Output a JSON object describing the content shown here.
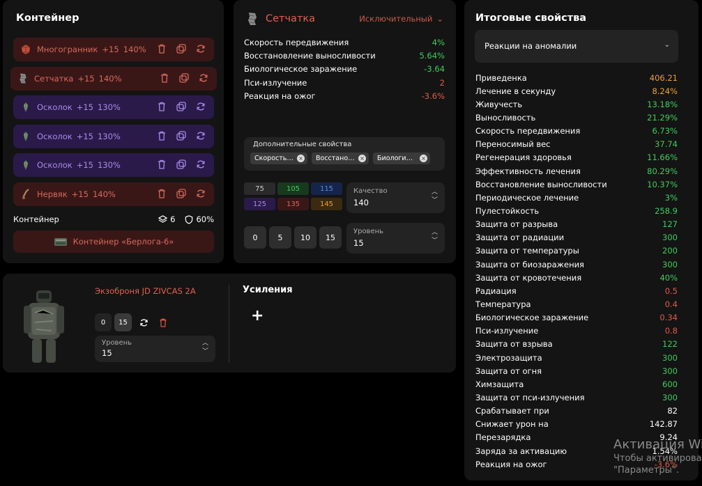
{
  "container": {
    "title": "Контейнер",
    "artifacts": [
      {
        "name": "Многогранник",
        "plus": "+15",
        "percent": "140%",
        "tone": "red",
        "icon": "polyhedron-artifact-icon"
      },
      {
        "name": "Сетчатка",
        "plus": "+15",
        "percent": "140%",
        "tone": "red",
        "icon": "mesh-artifact-icon"
      },
      {
        "name": "Осколок",
        "plus": "+15",
        "percent": "130%",
        "tone": "purple",
        "icon": "shard-artifact-icon"
      },
      {
        "name": "Осколок",
        "plus": "+15",
        "percent": "130%",
        "tone": "purple",
        "icon": "shard-artifact-icon"
      },
      {
        "name": "Осколок",
        "plus": "+15",
        "percent": "130%",
        "tone": "purple",
        "icon": "shard-artifact-icon"
      },
      {
        "name": "Нервяк",
        "plus": "+15",
        "percent": "140%",
        "tone": "red",
        "icon": "nerve-artifact-icon"
      }
    ],
    "footer_label": "Контейнер",
    "slots": "6",
    "protection": "60%",
    "container_button": "Контейнер «Берлога-6»"
  },
  "artifact_detail": {
    "name": "Сетчатка",
    "rarity": "Исключительный",
    "properties": [
      {
        "label": "Скорость передвижения",
        "value": "4%",
        "tone": "g"
      },
      {
        "label": "Восстановление выносливости",
        "value": "5.64%",
        "tone": "g"
      },
      {
        "label": "Биологическое заражение",
        "value": "-3.64",
        "tone": "g"
      },
      {
        "label": "Пси-излучение",
        "value": "2",
        "tone": "r"
      },
      {
        "label": "Реакция на ожог",
        "value": "-3.6%",
        "tone": "r"
      }
    ],
    "additional_label": "Дополнительные свойства",
    "chips": [
      "Скорость передвижения",
      "Восстановление выносливости",
      "Биологическое заражение"
    ],
    "quality_values": [
      "75",
      "105",
      "115",
      "125",
      "135",
      "145"
    ],
    "quality_label": "Качество",
    "quality_value": "140",
    "level_buttons": [
      "0",
      "5",
      "10",
      "15"
    ],
    "level_label": "Уровень",
    "level_value": "15"
  },
  "armor": {
    "name": "Экзоброня JD ZIVCAS 2A",
    "level_buttons": [
      "0",
      "15"
    ],
    "level_label": "Уровень",
    "level_value": "15",
    "boosts_title": "Усиления",
    "add_symbol": "+"
  },
  "final": {
    "title": "Итоговые свойства",
    "select_value": "Реакции на аномалии",
    "rows": [
      {
        "label": "Приведенка",
        "value": "406.21",
        "tone": "o"
      },
      {
        "label": "Лечение в секунду",
        "value": "8.24%",
        "tone": "o"
      },
      {
        "label": "Живучесть",
        "value": "13.18%",
        "tone": "g"
      },
      {
        "label": "Выносливость",
        "value": "21.29%",
        "tone": "g"
      },
      {
        "label": "Скорость передвижения",
        "value": "6.73%",
        "tone": "g"
      },
      {
        "label": "Переносимый вес",
        "value": "37.74",
        "tone": "g"
      },
      {
        "label": "Регенерация здоровья",
        "value": "11.66%",
        "tone": "g"
      },
      {
        "label": "Эффективность лечения",
        "value": "80.29%",
        "tone": "g"
      },
      {
        "label": "Восстановление выносливости",
        "value": "10.37%",
        "tone": "g"
      },
      {
        "label": "Периодическое лечение",
        "value": "3%",
        "tone": "g"
      },
      {
        "label": "Пулестойкость",
        "value": "258.9",
        "tone": "g"
      },
      {
        "label": "Защита от разрыва",
        "value": "127",
        "tone": "g"
      },
      {
        "label": "Защита от радиации",
        "value": "300",
        "tone": "g"
      },
      {
        "label": "Защита от температуры",
        "value": "200",
        "tone": "g"
      },
      {
        "label": "Защита от биозаражения",
        "value": "300",
        "tone": "g"
      },
      {
        "label": "Защита от кровотечения",
        "value": "40%",
        "tone": "g"
      },
      {
        "label": "Радиация",
        "value": "0.5",
        "tone": "r"
      },
      {
        "label": "Температура",
        "value": "0.4",
        "tone": "r"
      },
      {
        "label": "Биологическое заражение",
        "value": "0.34",
        "tone": "r"
      },
      {
        "label": "Пси-излучение",
        "value": "0.8",
        "tone": "r"
      },
      {
        "label": "Защита от взрыва",
        "value": "122",
        "tone": "g"
      },
      {
        "label": "Электрозащита",
        "value": "300",
        "tone": "g"
      },
      {
        "label": "Защита от огня",
        "value": "300",
        "tone": "g"
      },
      {
        "label": "Химзащита",
        "value": "600",
        "tone": "g"
      },
      {
        "label": "Защита от пси-излучения",
        "value": "300",
        "tone": "g"
      },
      {
        "label": "Срабатывает при",
        "value": "82",
        "tone": "w"
      },
      {
        "label": "Снижает урон на",
        "value": "142.87",
        "tone": "w"
      },
      {
        "label": "Перезарядка",
        "value": "9.24",
        "tone": "w"
      },
      {
        "label": "Заряда за активацию",
        "value": "1.54%",
        "tone": "w"
      },
      {
        "label": "Реакция на ожог",
        "value": "-3.6%",
        "tone": "r"
      }
    ]
  },
  "watermark": {
    "line1": "Активация Wi",
    "line2": "Чтобы активирова",
    "line3": "\"Параметры\"."
  },
  "colors": {
    "green": "#3fcc5c",
    "red": "#e05a4a",
    "orange": "#f0a030",
    "panel": "#141414"
  }
}
